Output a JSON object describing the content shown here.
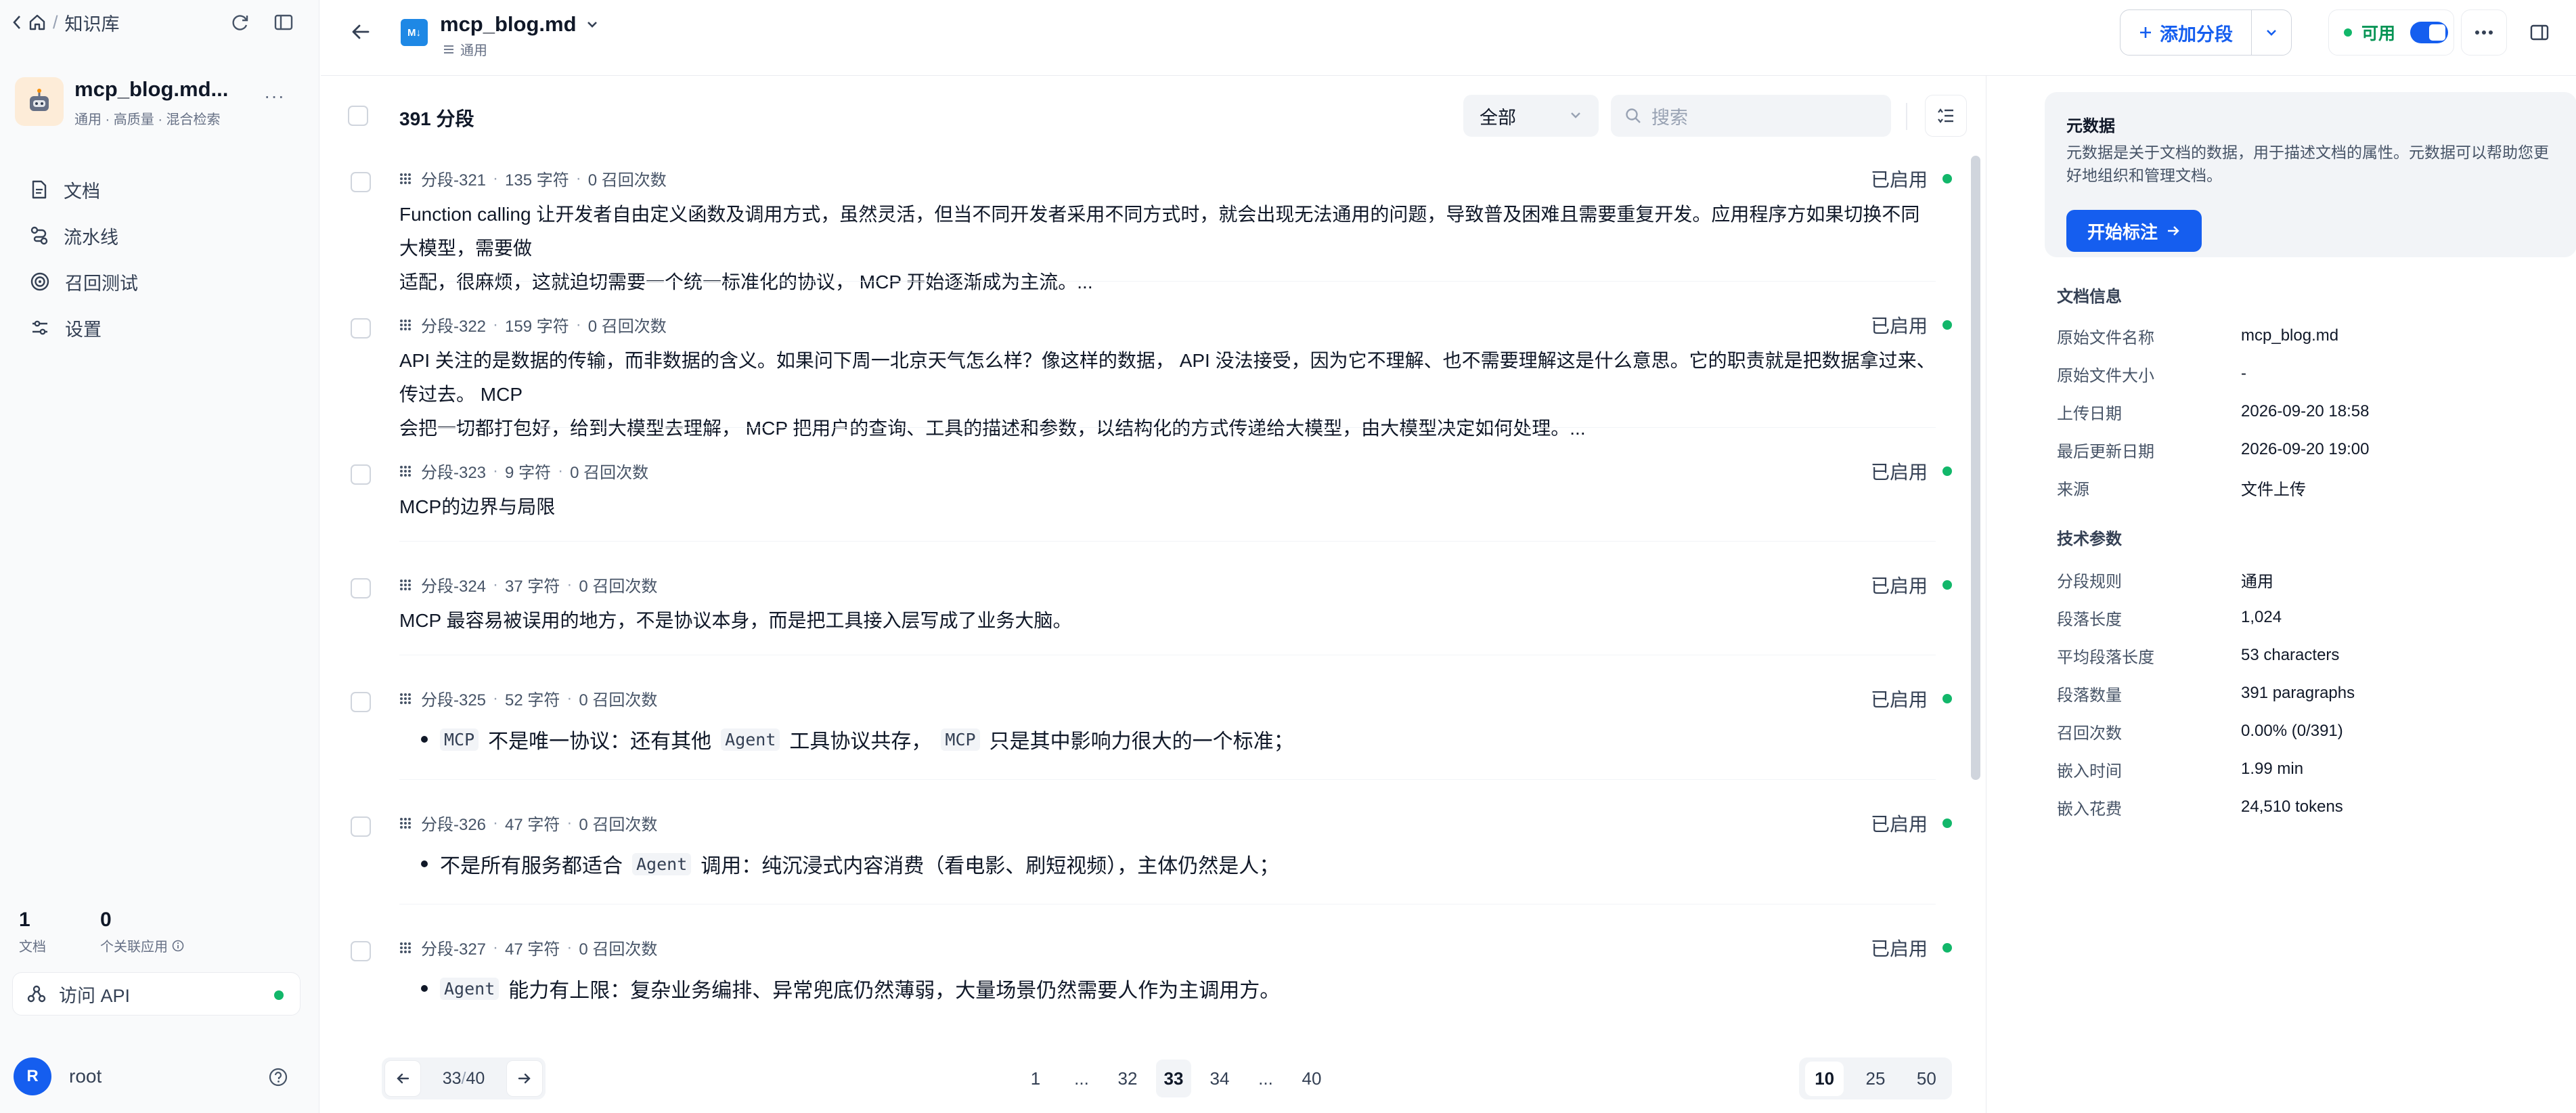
{
  "sidebar": {
    "breadcrumb": "知识库",
    "kb_name": "mcp_blog.md...",
    "kb_sub": "通用 · 高质量 · 混合检索",
    "nav": [
      {
        "label": "文档",
        "icon": "document-icon"
      },
      {
        "label": "流水线",
        "icon": "pipeline-icon"
      },
      {
        "label": "召回测试",
        "icon": "target-icon"
      },
      {
        "label": "设置",
        "icon": "settings-icon"
      }
    ],
    "stats": {
      "docs_num": "1",
      "docs_label": "文档",
      "apps_num": "0",
      "apps_label": "个关联应用"
    },
    "api_label": "访问 API",
    "user": {
      "initial": "R",
      "name": "root"
    }
  },
  "header": {
    "doc_icon_text": "M↓",
    "doc_title": "mcp_blog.md",
    "doc_sub": "通用",
    "add_segment": "添加分段",
    "available": "可用"
  },
  "toolbar": {
    "segment_count": "391 分段",
    "filter_value": "全部",
    "search_placeholder": "搜索"
  },
  "segments": [
    {
      "id": "分段-321",
      "chars": "135 字符",
      "recalls": "0 召回次数",
      "status": "已启用",
      "line1": "Function calling 让开发者自由定义函数及调用方式，虽然灵活，但当不同开发者采用不同方式时，就会出现无法通用的问题，导致普及困难且需要重复开发。应用程序方如果切换不同大模型，需要做",
      "line2": "适配，很麻烦，这就迫切需要一个统一标准化的协议， MCP 开始逐渐成为主流。..."
    },
    {
      "id": "分段-322",
      "chars": "159 字符",
      "recalls": "0 召回次数",
      "status": "已启用",
      "line1": "API 关注的是数据的传输，而非数据的含义。如果问下周一北京天气怎么样？像这样的数据， API 没法接受，因为它不理解、也不需要理解这是什么意思。它的职责就是把数据拿过来、传过去。 MCP",
      "line2": "会把一切都打包好，给到大模型去理解， MCP 把用户的查询、工具的描述和参数，以结构化的方式传递给大模型，由大模型决定如何处理。..."
    },
    {
      "id": "分段-323",
      "chars": "9 字符",
      "recalls": "0 召回次数",
      "status": "已启用",
      "line1": "MCP的边界与局限"
    },
    {
      "id": "分段-324",
      "chars": "37 字符",
      "recalls": "0 召回次数",
      "status": "已启用",
      "line1": "MCP 最容易被误用的地方，不是协议本身，而是把工具接入层写成了业务大脑。"
    },
    {
      "id": "分段-325",
      "chars": "52 字符",
      "recalls": "0 召回次数",
      "status": "已启用",
      "b1": "MCP",
      "b2": "不是唯一协议：还有其他",
      "b3": "Agent",
      "b4": "工具协议共存，",
      "b5": "MCP",
      "b6": "只是其中影响力很大的一个标准；"
    },
    {
      "id": "分段-326",
      "chars": "47 字符",
      "recalls": "0 召回次数",
      "status": "已启用",
      "b1": "不是所有服务都适合",
      "b2": "Agent",
      "b3": "调用：纯沉浸式内容消费（看电影、刷短视频），主体仍然是人；"
    },
    {
      "id": "分段-327",
      "chars": "47 字符",
      "recalls": "0 召回次数",
      "status": "已启用",
      "b1": "Agent",
      "b2": "能力有上限：复杂业务编排、异常兜底仍然薄弱，大量场景仍然需要人作为主调用方。"
    }
  ],
  "pagination": {
    "current": "33",
    "slash": "/",
    "total": "40",
    "pages": [
      "1",
      "...",
      "32",
      "33",
      "34",
      "...",
      "40"
    ],
    "sizes": [
      "10",
      "25",
      "50"
    ]
  },
  "right": {
    "meta_title": "元数据",
    "meta_desc": "元数据是关于文档的数据，用于描述文档的属性。元数据可以帮助您更好地组织和管理文档。",
    "meta_button": "开始标注",
    "doc_info_title": "文档信息",
    "doc_info": [
      {
        "k": "原始文件名称",
        "v": "mcp_blog.md"
      },
      {
        "k": "原始文件大小",
        "v": "-"
      },
      {
        "k": "上传日期",
        "v": "2026-09-20 18:58"
      },
      {
        "k": "最后更新日期",
        "v": "2026-09-20 19:00"
      },
      {
        "k": "来源",
        "v": "文件上传"
      }
    ],
    "tech_title": "技术参数",
    "tech": [
      {
        "k": "分段规则",
        "v": "通用"
      },
      {
        "k": "段落长度",
        "v": "1,024"
      },
      {
        "k": "平均段落长度",
        "v": "53 characters"
      },
      {
        "k": "段落数量",
        "v": "391 paragraphs"
      },
      {
        "k": "召回次数",
        "v": "0.00% (0/391)"
      },
      {
        "k": "嵌入时间",
        "v": "1.99 min"
      },
      {
        "k": "嵌入花费",
        "v": "24,510 tokens"
      }
    ]
  },
  "colors": {
    "accent": "#155eef",
    "success": "#12b76a"
  }
}
